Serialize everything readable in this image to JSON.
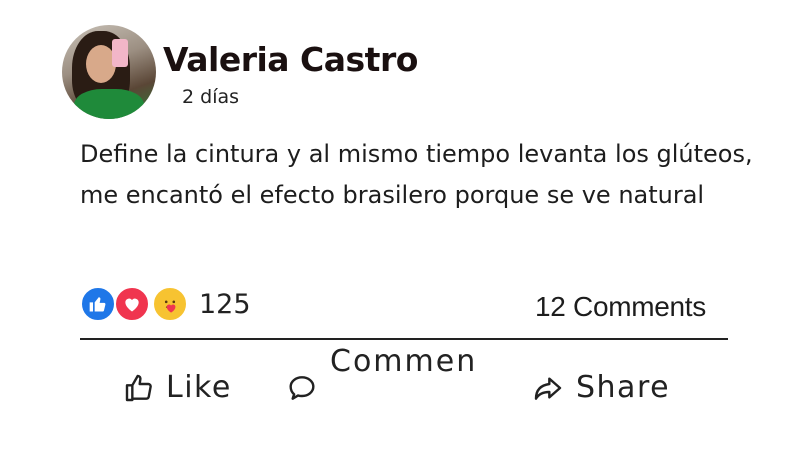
{
  "post": {
    "author": "Valeria Castro",
    "time": "2 días",
    "text": "Define la cintura y al mismo tiempo levanta los glúteos, me encantó el efecto brasilero porque se ve natural"
  },
  "stats": {
    "reaction_icons": [
      "like-icon",
      "love-icon",
      "care-icon"
    ],
    "reaction_count": "125",
    "comments": "12 Comments"
  },
  "actions": {
    "like": "Like",
    "comment": "Commen",
    "share": "Share"
  },
  "colors": {
    "like": "#1f77e8",
    "love": "#f0354f",
    "care": "#f7c331"
  }
}
